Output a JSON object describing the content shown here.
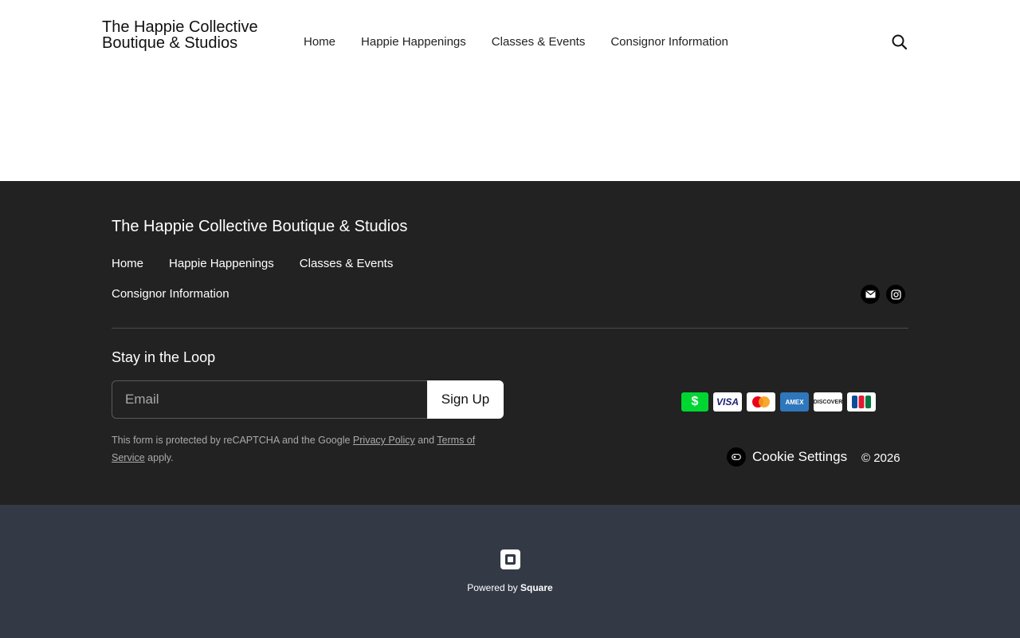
{
  "header": {
    "logo_text": "The Happie Collective Boutique & Studios",
    "nav": [
      "Home",
      "Happie Happenings",
      "Classes & Events",
      "Consignor Information"
    ],
    "search_icon": "search-icon"
  },
  "footer": {
    "title": "The Happie Collective Boutique & Studios",
    "nav_row1": [
      "Home",
      "Happie Happenings",
      "Classes & Events"
    ],
    "nav_row2": "Consignor Information",
    "social": [
      "mail-icon",
      "instagram-icon"
    ],
    "newsletter": {
      "title": "Stay in the Loop",
      "email_placeholder": "Email",
      "signup_label": "Sign Up",
      "recaptcha_prefix": "This form is protected by reCAPTCHA and the Google ",
      "privacy_link": "Privacy Policy",
      "and_text": " and ",
      "terms_link": "Terms of Service",
      "suffix": " apply."
    },
    "payments": [
      "$",
      "VISA",
      "mastercard",
      "AMEX",
      "DISCOVER",
      "JCB"
    ],
    "cookie_label": "Cookie Settings",
    "copyright": "© 2026"
  },
  "powered": {
    "prefix": "Powered by ",
    "brand": "Square"
  },
  "colors": {
    "footer_bg": "#222222",
    "powered_bg": "#333a45",
    "cash_app_green": "#00d632"
  }
}
